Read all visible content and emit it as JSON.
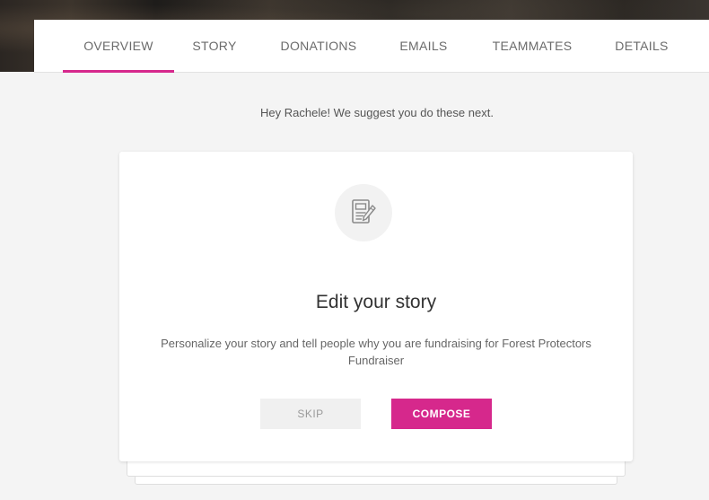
{
  "tabs": [
    {
      "label": "OVERVIEW",
      "active": true
    },
    {
      "label": "STORY"
    },
    {
      "label": "DONATIONS"
    },
    {
      "label": "EMAILS"
    },
    {
      "label": "TEAMMATES"
    },
    {
      "label": "DETAILS"
    }
  ],
  "suggestion": "Hey Rachele! We suggest you do these next.",
  "card": {
    "icon": "edit-document-icon",
    "title": "Edit your story",
    "description": "Personalize your story and tell people why you are fundraising for Forest Protectors Fundraiser",
    "skip_label": "SKIP",
    "compose_label": "COMPOSE"
  },
  "colors": {
    "accent": "#d6288c",
    "background": "#f4f4f4"
  }
}
